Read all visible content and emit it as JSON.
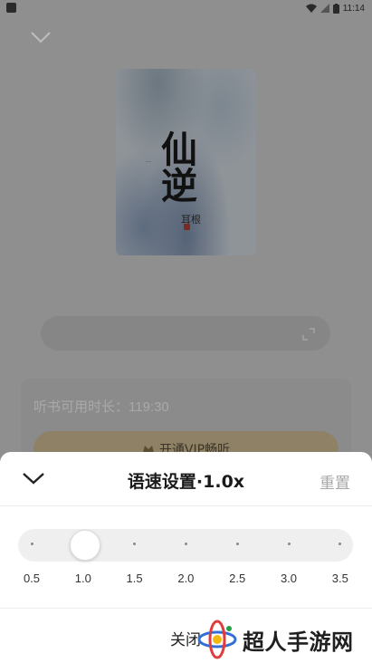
{
  "status_bar": {
    "time": "11:14"
  },
  "book": {
    "cover_title": "仙逆",
    "cover_author": "耳根"
  },
  "player": {
    "listen_time": "听书可用时长：119:30",
    "vip_button": "开通VIP畅听",
    "vip_icon": "crown-icon"
  },
  "speed_sheet": {
    "title": "语速设置·1.0x",
    "reset_label": "重置",
    "ticks": [
      "0.5",
      "1.0",
      "1.5",
      "2.0",
      "2.5",
      "3.0",
      "3.5"
    ],
    "selected_index": 1,
    "selected_value": 1.0,
    "close_label": "关闭"
  },
  "watermark": {
    "text": "超人手游网"
  },
  "colors": {
    "overlay_gray": "#8f8f8f",
    "sheet_background": "#ffffff",
    "reset_gray": "#a8a8a8",
    "track_gray": "#efefef",
    "vip_gold": "#8e8166"
  }
}
